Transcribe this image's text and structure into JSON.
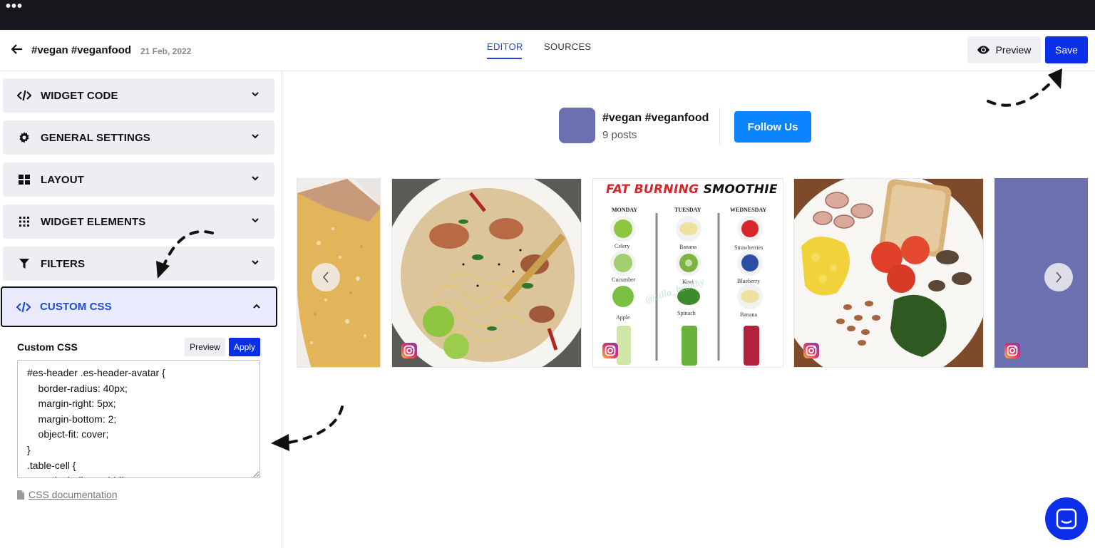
{
  "header": {
    "title": "#vegan #veganfood",
    "date": "21 Feb, 2022",
    "tabs": [
      {
        "label": "EDITOR",
        "active": true
      },
      {
        "label": "SOURCES",
        "active": false
      }
    ],
    "preview_label": "Preview",
    "save_label": "Save"
  },
  "sidebar": {
    "sections": [
      {
        "label": "WIDGET CODE",
        "icon": "code-icon"
      },
      {
        "label": "GENERAL SETTINGS",
        "icon": "gear-icon"
      },
      {
        "label": "LAYOUT",
        "icon": "layout-grid-icon"
      },
      {
        "label": "WIDGET ELEMENTS",
        "icon": "elements-grid-icon"
      },
      {
        "label": "FILTERS",
        "icon": "filter-icon"
      },
      {
        "label": "CUSTOM CSS",
        "icon": "code-icon",
        "expanded": true
      }
    ],
    "custom_css": {
      "label": "Custom CSS",
      "preview_label": "Preview",
      "apply_label": "Apply",
      "code": "#es-header .es-header-avatar {\n    border-radius: 40px;\n    margin-right: 5px;\n    margin-bottom: 2;\n    object-fit: cover;\n}\n.table-cell {\n    vertical-align: middle;",
      "doc_link": "CSS documentation"
    }
  },
  "widget": {
    "profile_name": "#vegan #veganfood",
    "posts_count": "9 posts",
    "follow_label": "Follow Us",
    "smoothie_post": {
      "heading_left": "FAT BURNING",
      "heading_right": "SMOOTHIE",
      "days": [
        "MONDAY",
        "TUESDAY",
        "WEDNESDAY"
      ],
      "monday": [
        "Celery",
        "Cucumber",
        "Apple"
      ],
      "tuesday": [
        "Banana",
        "Kiwi",
        "Spinach"
      ],
      "wednesday": [
        "Strawberries",
        "Blueberry",
        "Banana"
      ],
      "watermark": "@cilla_healthy"
    }
  },
  "colors": {
    "accent": "#0b2ee8",
    "follow": "#0a84ff",
    "avatar": "#6b70b0",
    "topbar": "#16181d"
  }
}
